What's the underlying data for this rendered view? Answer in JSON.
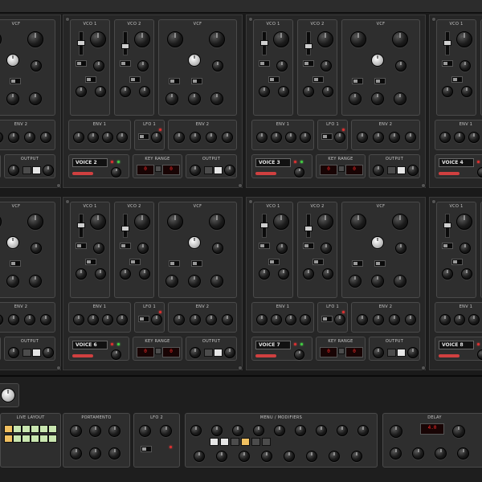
{
  "voices": [
    {
      "name": "VOICE 1"
    },
    {
      "name": "VOICE 2"
    },
    {
      "name": "VOICE 3"
    },
    {
      "name": "VOICE 4"
    },
    {
      "name": "VOICE 5"
    },
    {
      "name": "VOICE 6"
    },
    {
      "name": "VOICE 7"
    },
    {
      "name": "VOICE 8"
    }
  ],
  "labels": {
    "vco1": "VCO 1",
    "vco2": "VCO 2",
    "vcf": "VCF",
    "env1": "ENV 1",
    "env2": "ENV 2",
    "lfo1": "LFO 1",
    "key_range": "KEY RANGE",
    "output": "OUTPUT"
  },
  "key_display": "0",
  "bottom": {
    "live_layout": "LIVE LAYOUT",
    "portamento": "PORTAMENTO",
    "lfo2": "LFO 2",
    "menu": "MENU / MODIFIERS",
    "delay": "DELAY",
    "delay_display": "4.0"
  },
  "colors": {
    "panel": "#2e2e2e",
    "led_red": "#e03030",
    "led_green": "#40d040",
    "display_red": "#ff2a2a"
  }
}
